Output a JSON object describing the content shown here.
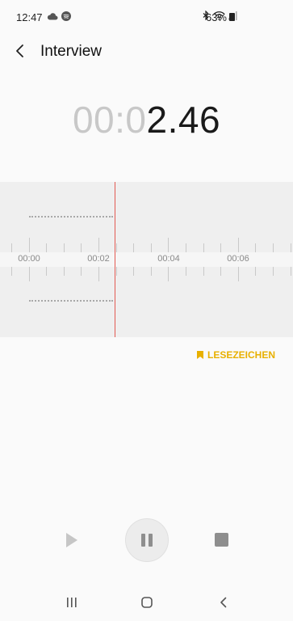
{
  "status_bar": {
    "time": "12:47",
    "battery": "63%"
  },
  "header": {
    "title": "Interview"
  },
  "recorder": {
    "timer_dim": "00:0",
    "timer_bright": "2.46",
    "timeline_labels": [
      "00:00",
      "00:02",
      "00:04",
      "00:06"
    ],
    "bookmark_label": "LESEZEICHEN"
  },
  "colors": {
    "accent": "#e8b000",
    "playhead": "#e35a52"
  },
  "icons": {
    "status_left": [
      "cloud-icon",
      "spotify-icon"
    ],
    "status_right": [
      "bluetooth-icon",
      "wifi-icon",
      "signal-icon",
      "battery-icon"
    ],
    "header_back": "back-arrow-icon",
    "controls": [
      "play-icon",
      "pause-icon",
      "stop-icon"
    ],
    "nav": [
      "recent-apps-icon",
      "home-icon",
      "back-icon"
    ]
  }
}
